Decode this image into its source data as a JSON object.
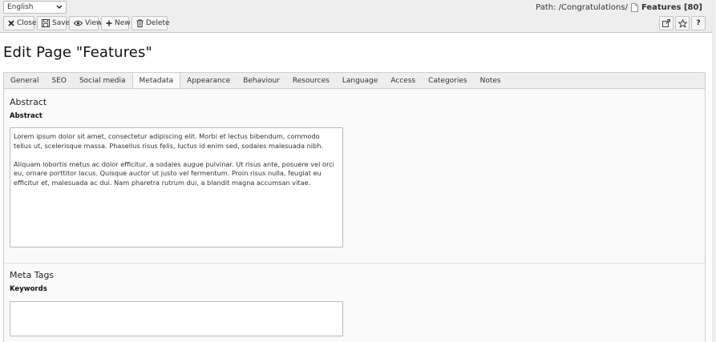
{
  "header": {
    "language": "English",
    "path_label": "Path: /Congratulations/",
    "page_label": "Features [80]"
  },
  "toolbar": {
    "close": "Close",
    "save": "Save",
    "view": "View",
    "new": "New",
    "delete": "Delete"
  },
  "page": {
    "title": "Edit Page \"Features\""
  },
  "tabs": [
    {
      "label": "General",
      "active": false
    },
    {
      "label": "SEO",
      "active": false
    },
    {
      "label": "Social media",
      "active": false
    },
    {
      "label": "Metadata",
      "active": true
    },
    {
      "label": "Appearance",
      "active": false
    },
    {
      "label": "Behaviour",
      "active": false
    },
    {
      "label": "Resources",
      "active": false
    },
    {
      "label": "Language",
      "active": false
    },
    {
      "label": "Access",
      "active": false
    },
    {
      "label": "Categories",
      "active": false
    },
    {
      "label": "Notes",
      "active": false
    }
  ],
  "sections": {
    "abstract": {
      "title": "Abstract",
      "field_label": "Abstract",
      "value": "Lorem ipsum dolor sit amet, consectetur adipiscing elit. Morbi et lectus bibendum, commodo tellus ut, scelerisque massa. Phasellus risus felis, luctus id enim sed, sodales malesuada nibh.\n\nAliquam lobortis metus ac dolor efficitur, a sodales augue pulvinar. Ut risus ante, posuere vel orci eu, ornare porttitor lacus. Quisque auctor ut justo vel fermentum. Proin risus nulla, feugiat eu efficitur et, malesuada ac dui. Nam pharetra rutrum dui, a blandit magna accumsan vitae."
    },
    "meta_tags": {
      "title": "Meta Tags",
      "field_label": "Keywords",
      "value": ""
    }
  }
}
